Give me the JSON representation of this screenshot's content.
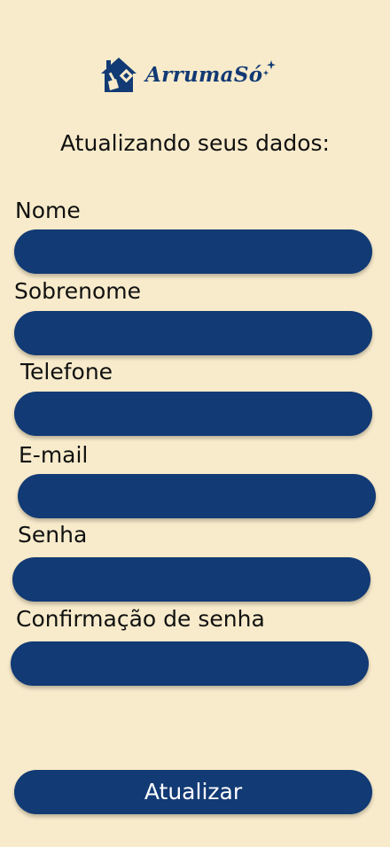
{
  "header": {
    "logo_text": "ArrumaSó",
    "title": "Atualizando seus dados:"
  },
  "form": {
    "fields": [
      {
        "label": "Nome",
        "value": ""
      },
      {
        "label": "Sobrenome",
        "value": ""
      },
      {
        "label": "Telefone",
        "value": ""
      },
      {
        "label": "E-mail",
        "value": ""
      },
      {
        "label": "Senha",
        "value": ""
      },
      {
        "label": "Confirmação de senha",
        "value": ""
      }
    ],
    "submit_label": "Atualizar"
  },
  "colors": {
    "background": "#f8ebcb",
    "primary": "#123a74",
    "text": "#111111",
    "button_text": "#ffffff"
  },
  "icons": {
    "logo": "house-broom-icon",
    "sparkle": "sparkle-icon"
  }
}
